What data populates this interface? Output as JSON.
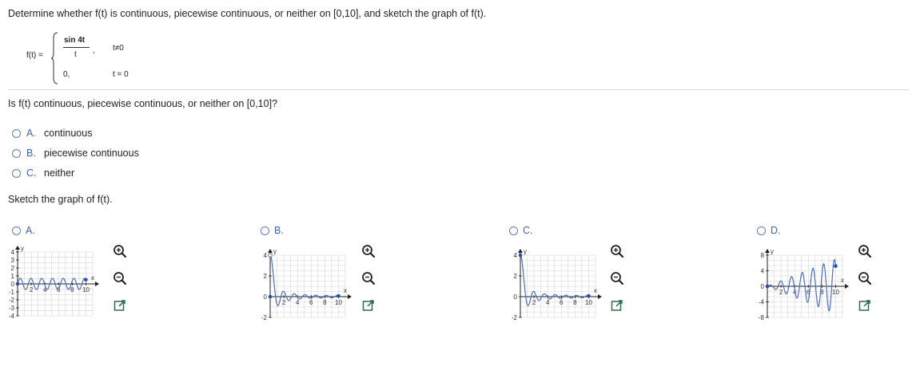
{
  "problem": {
    "prompt": "Determine whether f(t) is continuous, piecewise continuous, or neither on [0,10], and sketch the graph of f(t).",
    "function": {
      "lhs": "f(t) =",
      "numerator": "sin 4t",
      "denominator": "t",
      "comma": ",",
      "condition1": "t≠0",
      "case2_value": "0,",
      "condition2": "t = 0"
    }
  },
  "question1": {
    "text": "Is f(t) continuous, piecewise continuous, or neither on [0,10]?",
    "options": [
      {
        "letter": "A.",
        "label": "continuous"
      },
      {
        "letter": "B.",
        "label": "piecewise continuous"
      },
      {
        "letter": "C.",
        "label": "neither"
      }
    ]
  },
  "question2": {
    "text": "Sketch the graph of f(t).",
    "graphs": [
      {
        "letter": "A.",
        "y_ticks": [
          "4",
          "3",
          "2",
          "1",
          "0",
          "-1",
          "-2",
          "-3",
          "-4"
        ],
        "x_ticks": [
          "2",
          "4",
          "6",
          "8",
          "10"
        ],
        "y_label": "y",
        "x_label": "x",
        "ylim": [
          -4,
          4
        ]
      },
      {
        "letter": "B.",
        "y_ticks": [
          "4",
          "2",
          "0",
          "-2"
        ],
        "x_ticks": [
          "2",
          "4",
          "6",
          "8",
          "10"
        ],
        "y_label": "y",
        "x_label": "x",
        "ylim": [
          -2,
          4
        ]
      },
      {
        "letter": "C.",
        "y_ticks": [
          "4",
          "2",
          "0",
          "-2"
        ],
        "x_ticks": [
          "2",
          "4",
          "6",
          "8",
          "10"
        ],
        "y_label": "y",
        "x_label": "x",
        "ylim": [
          -2,
          4
        ]
      },
      {
        "letter": "D.",
        "y_ticks": [
          "8",
          "4",
          "0",
          "-4",
          "-8"
        ],
        "x_ticks": [
          "2",
          "4",
          "6",
          "8",
          "10"
        ],
        "y_label": "y",
        "x_label": "x",
        "ylim": [
          -8,
          8
        ]
      }
    ]
  },
  "colors": {
    "accent": "#3a66b5",
    "curve": "#4a6fc0",
    "grid": "#d4d4d4",
    "tool": "#2c6e49"
  }
}
